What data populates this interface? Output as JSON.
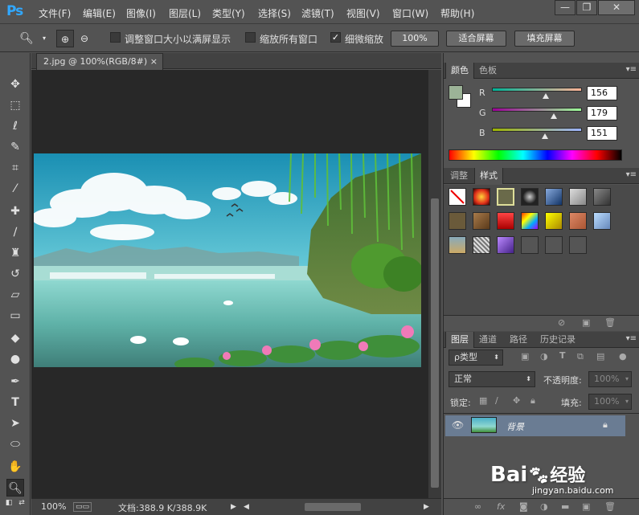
{
  "app": {
    "logo": "Ps"
  },
  "menu": {
    "items": [
      "文件(F)",
      "编辑(E)",
      "图像(I)",
      "图层(L)",
      "类型(Y)",
      "选择(S)",
      "滤镜(T)",
      "视图(V)",
      "窗口(W)",
      "帮助(H)"
    ]
  },
  "window_controls": {
    "minimize": "—",
    "restore": "❐",
    "close": "✕"
  },
  "options": {
    "resize_windows_label": "调整窗口大小以满屏显示",
    "resize_windows_checked": false,
    "zoom_all_label": "缩放所有窗口",
    "zoom_all_checked": false,
    "scrubby_zoom_label": "细微缩放",
    "scrubby_zoom_checked": true,
    "zoom_100_button": "100%",
    "fit_screen_button": "适合屏幕",
    "fill_screen_button": "填充屏幕"
  },
  "document": {
    "tab_title": "2.jpg @ 100%(RGB/8#)",
    "tab_close": "×",
    "zoom": "100%",
    "doc_info": "文档:388.9 K/388.9K"
  },
  "color_panel": {
    "tabs": [
      "颜色",
      "色板"
    ],
    "r_label": "R",
    "g_label": "G",
    "b_label": "B",
    "r": "156",
    "g": "179",
    "b": "151",
    "fg_color": "#9cb397",
    "bg_color": "#ffffff"
  },
  "styles_panel": {
    "tabs": [
      "调整",
      "样式"
    ]
  },
  "layers_panel": {
    "tabs": [
      "图层",
      "通道",
      "路径",
      "历史记录"
    ],
    "filter_label": "ρ类型",
    "blend_mode": "正常",
    "opacity_label": "不透明度:",
    "opacity_value": "100%",
    "lock_label": "锁定:",
    "fill_label": "填充:",
    "fill_value": "100%",
    "layers": [
      {
        "name": "背景",
        "visible": true,
        "locked": true
      }
    ]
  },
  "watermark": {
    "brand": "Bai",
    "brand2": "经验",
    "url": "jingyan.baidu.com"
  }
}
